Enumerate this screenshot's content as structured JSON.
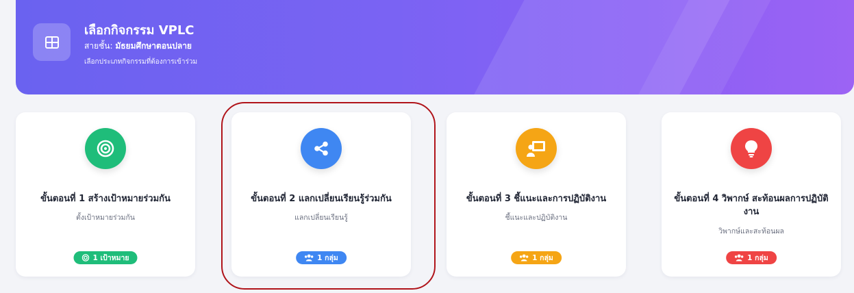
{
  "header": {
    "title": "เลือกกิจกรรม VPLC",
    "level_label": "สายชั้น: ",
    "level_value": "มัธยมศึกษาตอนปลาย",
    "description": "เลือกประเภทกิจกรรมที่ต้องการเข้าร่วม",
    "icon": "grid-icon"
  },
  "cards": [
    {
      "title": "ขั้นตอนที่ 1 สร้างเป้าหมายร่วมกัน",
      "subtitle": "ตั้งเป้าหมายร่วมกัน",
      "badge": "1 เป้าหมาย",
      "icon": "target-icon",
      "color": "#1fbd7a"
    },
    {
      "title": "ขั้นตอนที่ 2 แลกเปลี่ยนเรียนรู้ร่วมกัน",
      "subtitle": "แลกเปลี่ยนเรียนรู้",
      "badge": "1 กลุ่ม",
      "icon": "share-icon",
      "color": "#3f87f2"
    },
    {
      "title": "ขั้นตอนที่ 3 ชี้แนะและการปฏิบัติงาน",
      "subtitle": "ชี้แนะและปฏิบัติงาน",
      "badge": "1 กลุ่ม",
      "icon": "presentation-icon",
      "color": "#f5a515"
    },
    {
      "title": "ขั้นตอนที่ 4 วิพากษ์ สะท้อนผลการปฏิบัติงาน",
      "subtitle": "วิพากษ์และสะท้อนผล",
      "badge": "1 กลุ่ม",
      "icon": "lightbulb-icon",
      "color": "#ef4444"
    }
  ],
  "colors": {
    "banner_start": "#6a62f0",
    "banner_end": "#9c63f4",
    "highlight": "#b0141a"
  }
}
